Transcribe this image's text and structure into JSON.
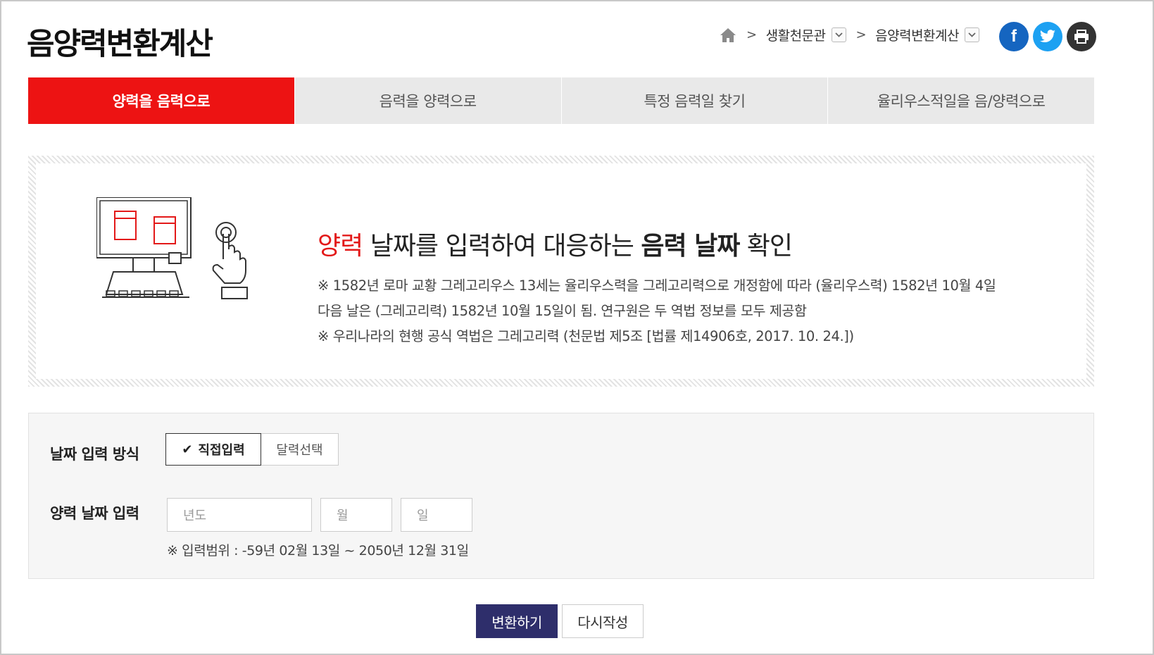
{
  "page": {
    "title": "음양력변환계산"
  },
  "breadcrumb": {
    "items": [
      "생활천문관",
      "음양력변환계산"
    ]
  },
  "share": {
    "facebook_label": "f"
  },
  "tabs": [
    {
      "label": "양력을 음력으로",
      "active": true
    },
    {
      "label": "음력을 양력으로",
      "active": false
    },
    {
      "label": "특정 음력일 찾기",
      "active": false
    },
    {
      "label": "율리우스적일을 음/양력으로",
      "active": false
    }
  ],
  "info": {
    "headline": {
      "part1": "양력",
      "part2": " 날짜를 입력하여 대응하는 ",
      "part3": "음력 날짜",
      "part4": " 확인"
    },
    "notes": [
      "※ 1582년 로마 교황 그레고리우스 13세는 율리우스력을 그레고리력으로 개정함에 따라 (율리우스력) 1582년 10월 4일",
      "다음 날은 (그레고리력) 1582년 10월 15일이 됨. 연구원은 두 역법 정보를 모두 제공함",
      "※ 우리나라의 현행 공식 역법은 그레고리력 (천문법 제5조 [법률 제14906호, 2017. 10. 24.])"
    ]
  },
  "form": {
    "method_label": "날짜 입력 방식",
    "method_options": [
      "직접입력",
      "달력선택"
    ],
    "date_label": "양력 날짜 입력",
    "year_placeholder": "년도",
    "month_placeholder": "월",
    "day_placeholder": "일",
    "range_note": "※ 입력범위 : -59년 02월 13일 ~ 2050년 12월 31일"
  },
  "buttons": {
    "convert": "변환하기",
    "reset": "다시작성"
  },
  "colors": {
    "accent": "#ed1313",
    "primary_button": "#2e2e6b",
    "facebook": "#1565c0",
    "twitter": "#1da1f2"
  }
}
